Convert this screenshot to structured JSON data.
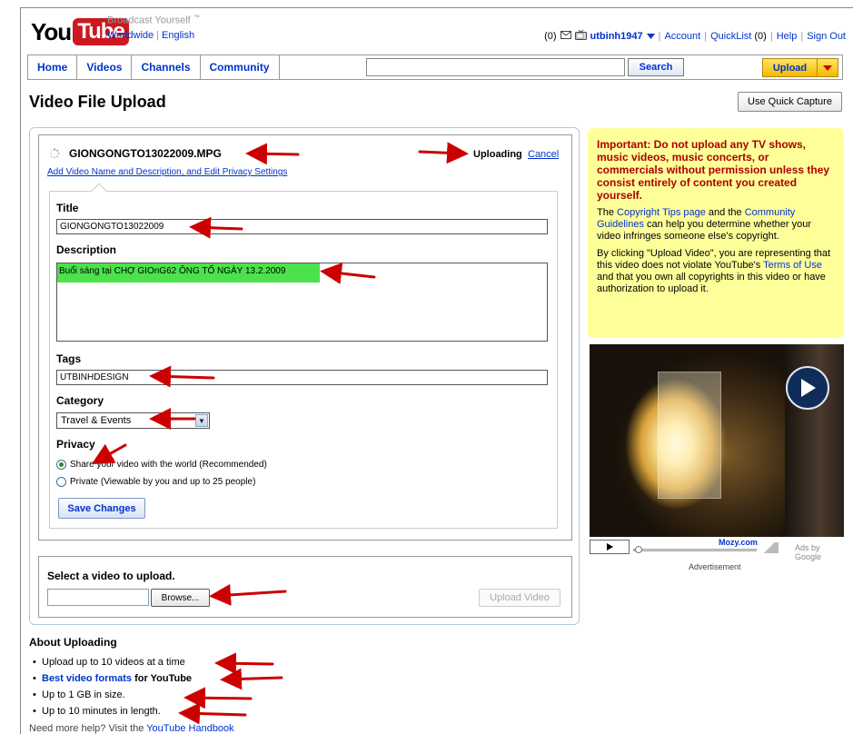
{
  "header": {
    "logo_you": "You",
    "logo_tube": "Tube",
    "tagline": "Broadcast Yourself",
    "tagline_tm": "™",
    "locale_region": "Worldwide",
    "locale_language": "English",
    "inbox_count": "(0)",
    "username": "utbinh1947",
    "account": "Account",
    "quicklist": "QuickList",
    "quicklist_count": "(0)",
    "help": "Help",
    "signout": "Sign Out"
  },
  "nav": {
    "tabs": [
      "Home",
      "Videos",
      "Channels",
      "Community"
    ],
    "search_value": "",
    "search_button": "Search",
    "upload_button": "Upload"
  },
  "page": {
    "title": "Video File Upload",
    "quick_capture": "Use Quick Capture"
  },
  "upload": {
    "file_name": "GIONGONGTO13022009.MPG",
    "status": "Uploading",
    "cancel": "Cancel",
    "edit_link": "Add Video Name and Description, and Edit Privacy Settings",
    "title_label": "Title",
    "title_value": "GIONGONGTO13022009",
    "description_label": "Description",
    "description_value": "Buổi sáng tại CHỢ GIOnG62 ÔNG TỐ NGÀY 13.2.2009",
    "tags_label": "Tags",
    "tags_value": "UTBINHDESIGN",
    "category_label": "Category",
    "category_value": "Travel & Events",
    "privacy_label": "Privacy",
    "privacy_public": "Share your video with the world (Recommended)",
    "privacy_private": "Private (Viewable by you and up to 25 people)",
    "privacy_selected": "public",
    "save_button": "Save Changes"
  },
  "select_video": {
    "title": "Select a video to upload.",
    "file_value": "",
    "browse": "Browse...",
    "upload_video": "Upload Video"
  },
  "notice": {
    "warning": "Important: Do not upload any TV shows, music videos, music concerts, or commercials without permission unless they consist entirely of content you created yourself.",
    "p1_a": "The ",
    "p1_link1": "Copyright Tips page",
    "p1_b": " and the ",
    "p1_link2": "Community Guidelines",
    "p1_c": " can help you determine whether your video infringes someone else's copyright.",
    "p2_a": "By clicking \"Upload Video\", you are representing that this video does not violate YouTube's ",
    "p2_link": "Terms of Use",
    "p2_b": " and that you own all copyrights in this video or have authorization to upload it."
  },
  "ad": {
    "brand": "Mozy.com",
    "ads_by": "Ads by Google",
    "label": "Advertisement"
  },
  "about": {
    "title": "About Uploading",
    "item1": "Upload up to 10 videos at a time",
    "item2_link": "Best video formats",
    "item2_rest": " for YouTube",
    "item3": "Up to 1 GB in size.",
    "item4": "Up to 10 minutes in length.",
    "help_text": "Need more help? Visit the ",
    "help_link": "YouTube Handbook"
  },
  "colors": {
    "link": "#0033cc",
    "annotation_arrow": "#cc0000",
    "notice_bg": "#ffff99",
    "warning_text": "#aa0000",
    "description_highlight": "#4ce24c",
    "upload_button": "#f5b800"
  }
}
